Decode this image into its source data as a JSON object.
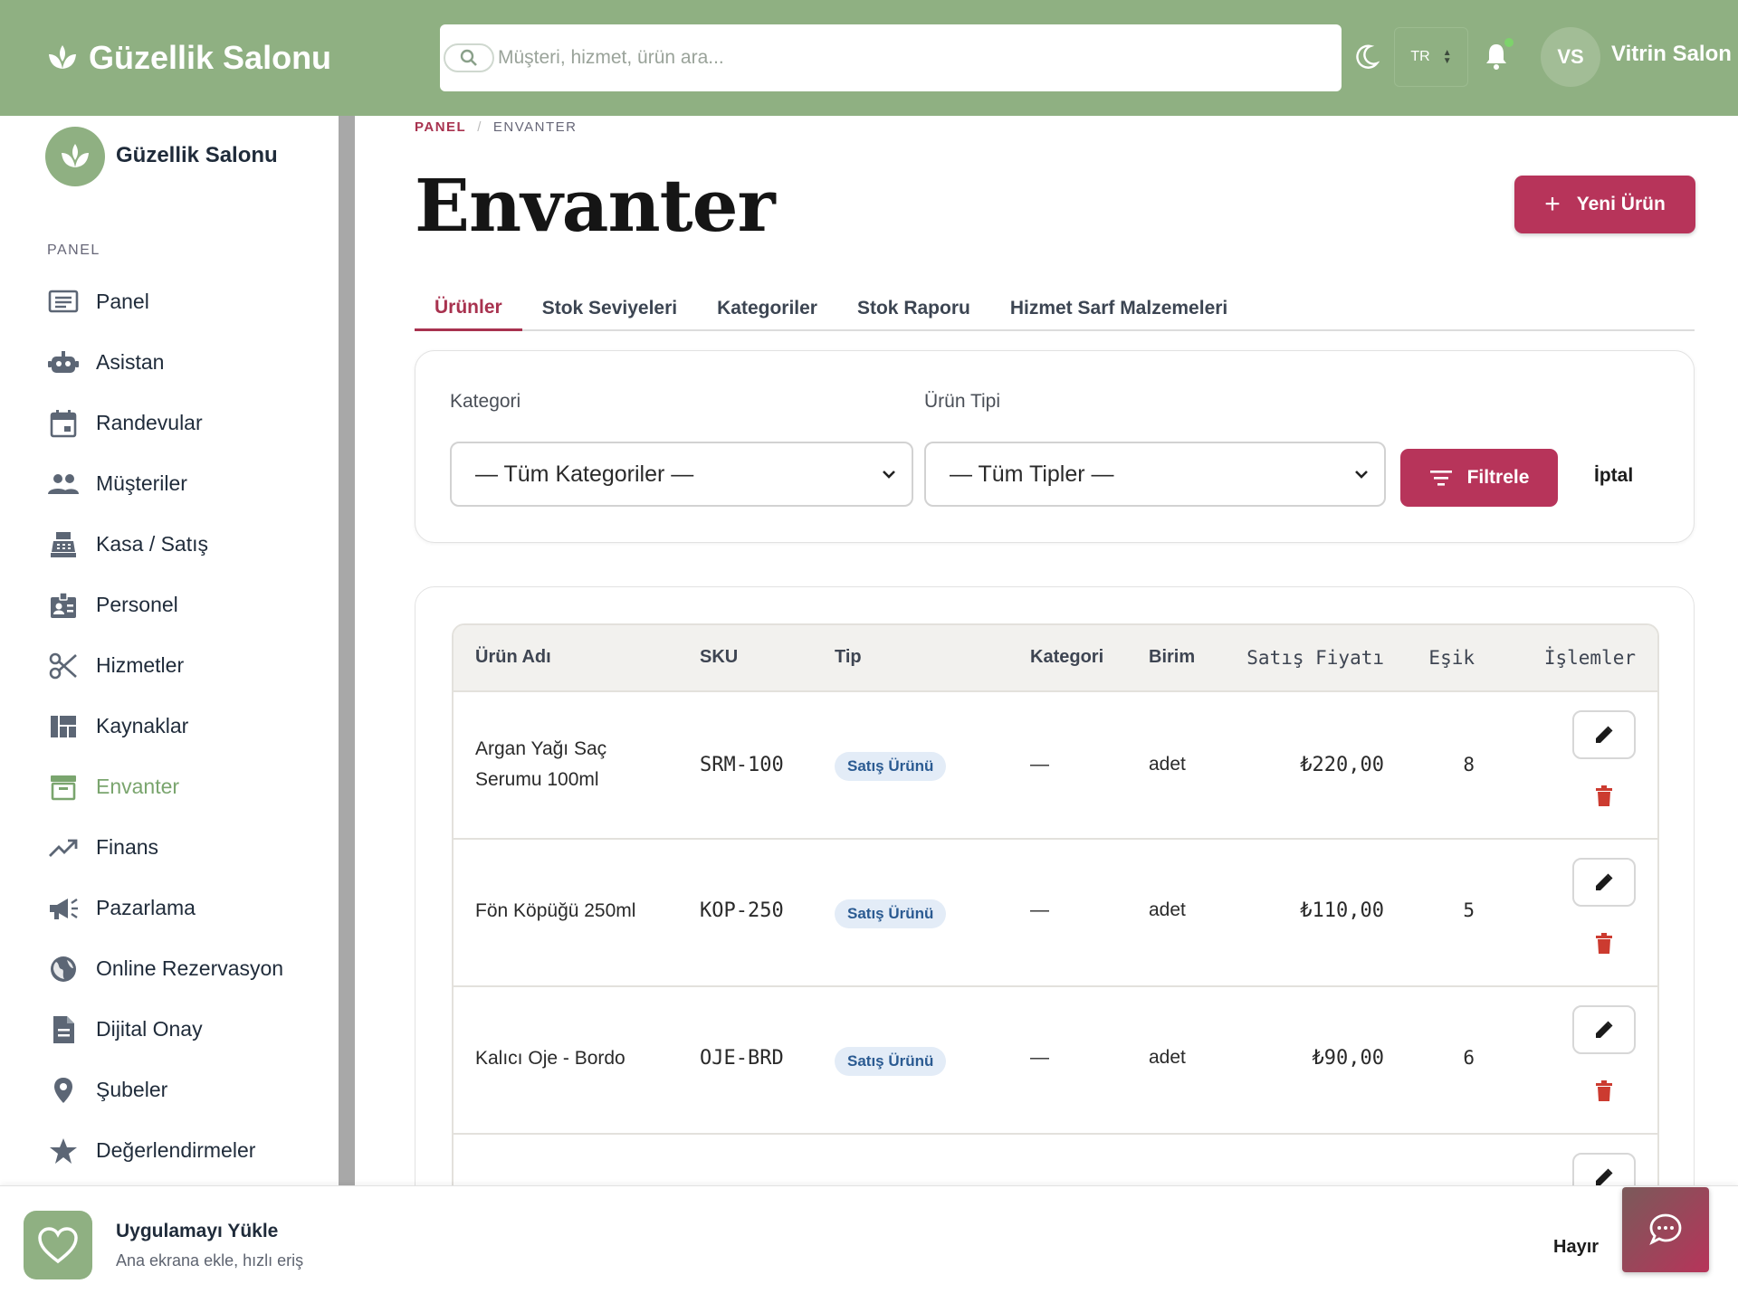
{
  "header": {
    "brand": "Güzellik Salonu",
    "search_placeholder": "Müşteri, hizmet, ürün ara...",
    "lang": "TR",
    "avatar_initials": "VS",
    "user_name": "Vitrin Salon"
  },
  "sidebar": {
    "logo_text": "Güzellik Salonu",
    "section": "PANEL",
    "items": [
      {
        "label": "Panel",
        "icon": "dashboard-icon"
      },
      {
        "label": "Asistan",
        "icon": "robot-icon"
      },
      {
        "label": "Randevular",
        "icon": "calendar-icon"
      },
      {
        "label": "Müşteriler",
        "icon": "people-icon"
      },
      {
        "label": "Kasa / Satış",
        "icon": "cash-register-icon"
      },
      {
        "label": "Personel",
        "icon": "badge-icon"
      },
      {
        "label": "Hizmetler",
        "icon": "scissors-icon"
      },
      {
        "label": "Kaynaklar",
        "icon": "grid-icon"
      },
      {
        "label": "Envanter",
        "icon": "archive-icon",
        "active": true
      },
      {
        "label": "Finans",
        "icon": "trending-up-icon"
      },
      {
        "label": "Pazarlama",
        "icon": "megaphone-icon"
      },
      {
        "label": "Online Rezervasyon",
        "icon": "globe-icon"
      },
      {
        "label": "Dijital Onay",
        "icon": "document-icon"
      },
      {
        "label": "Şubeler",
        "icon": "location-pin-icon"
      },
      {
        "label": "Değerlendirmeler",
        "icon": "star-icon"
      }
    ]
  },
  "breadcrumb": {
    "root": "PANEL",
    "current": "ENVANTER"
  },
  "page": {
    "title": "Envanter",
    "new_button": "Yeni Ürün"
  },
  "tabs": [
    "Ürünler",
    "Stok Seviyeleri",
    "Kategoriler",
    "Stok Raporu",
    "Hizmet Sarf Malzemeleri"
  ],
  "filters": {
    "category_label": "Kategori",
    "category_value": "— Tüm Kategoriler —",
    "type_label": "Ürün Tipi",
    "type_value": "— Tüm Tipler —",
    "filter_button": "Filtrele",
    "cancel_button": "İptal"
  },
  "table": {
    "columns": [
      "Ürün Adı",
      "SKU",
      "Tip",
      "Kategori",
      "Birim",
      "Satış Fiyatı",
      "Eşik",
      "İşlemler"
    ],
    "rows": [
      {
        "name": "Argan Yağı Saç Serumu 100ml",
        "sku": "SRM-100",
        "type": "Satış Ürünü",
        "category": "—",
        "unit": "adet",
        "price": "₺220,00",
        "threshold": "8"
      },
      {
        "name": "Fön Köpüğü 250ml",
        "sku": "KOP-250",
        "type": "Satış Ürünü",
        "category": "—",
        "unit": "adet",
        "price": "₺110,00",
        "threshold": "5"
      },
      {
        "name": "Kalıcı Oje - Bordo",
        "sku": "OJE-BRD",
        "type": "Satış Ürünü",
        "category": "—",
        "unit": "adet",
        "price": "₺90,00",
        "threshold": "6"
      }
    ]
  },
  "install_bar": {
    "title": "Uygulamayı Yükle",
    "subtitle": "Ana ekrana ekle, hızlı eriş",
    "dismiss": "Hayır"
  },
  "colors": {
    "topbar": "#8fb082",
    "accent": "#b7345a",
    "active_nav": "#7aa56e"
  }
}
